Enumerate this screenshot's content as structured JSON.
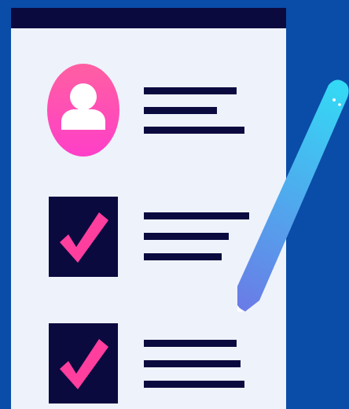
{
  "illustration": {
    "colors": {
      "background": "#0A4DA8",
      "sheet": "#EEF2FB",
      "ink": "#0B0A3F",
      "avatar_top": "#FF5FA2",
      "avatar_bottom": "#FF3FC8",
      "check": "#FF3E9E",
      "avatar_figure": "#FFFFFF",
      "pencil_light": "#34D9F5",
      "pencil_dark": "#6A7CE6"
    },
    "icons": [
      "user-avatar-icon",
      "checkmark-icon",
      "checkmark-icon",
      "pencil-icon"
    ],
    "items": [
      {
        "type": "profile",
        "lines": 3
      },
      {
        "type": "checked",
        "lines": 3
      },
      {
        "type": "checked",
        "lines": 3
      }
    ]
  }
}
